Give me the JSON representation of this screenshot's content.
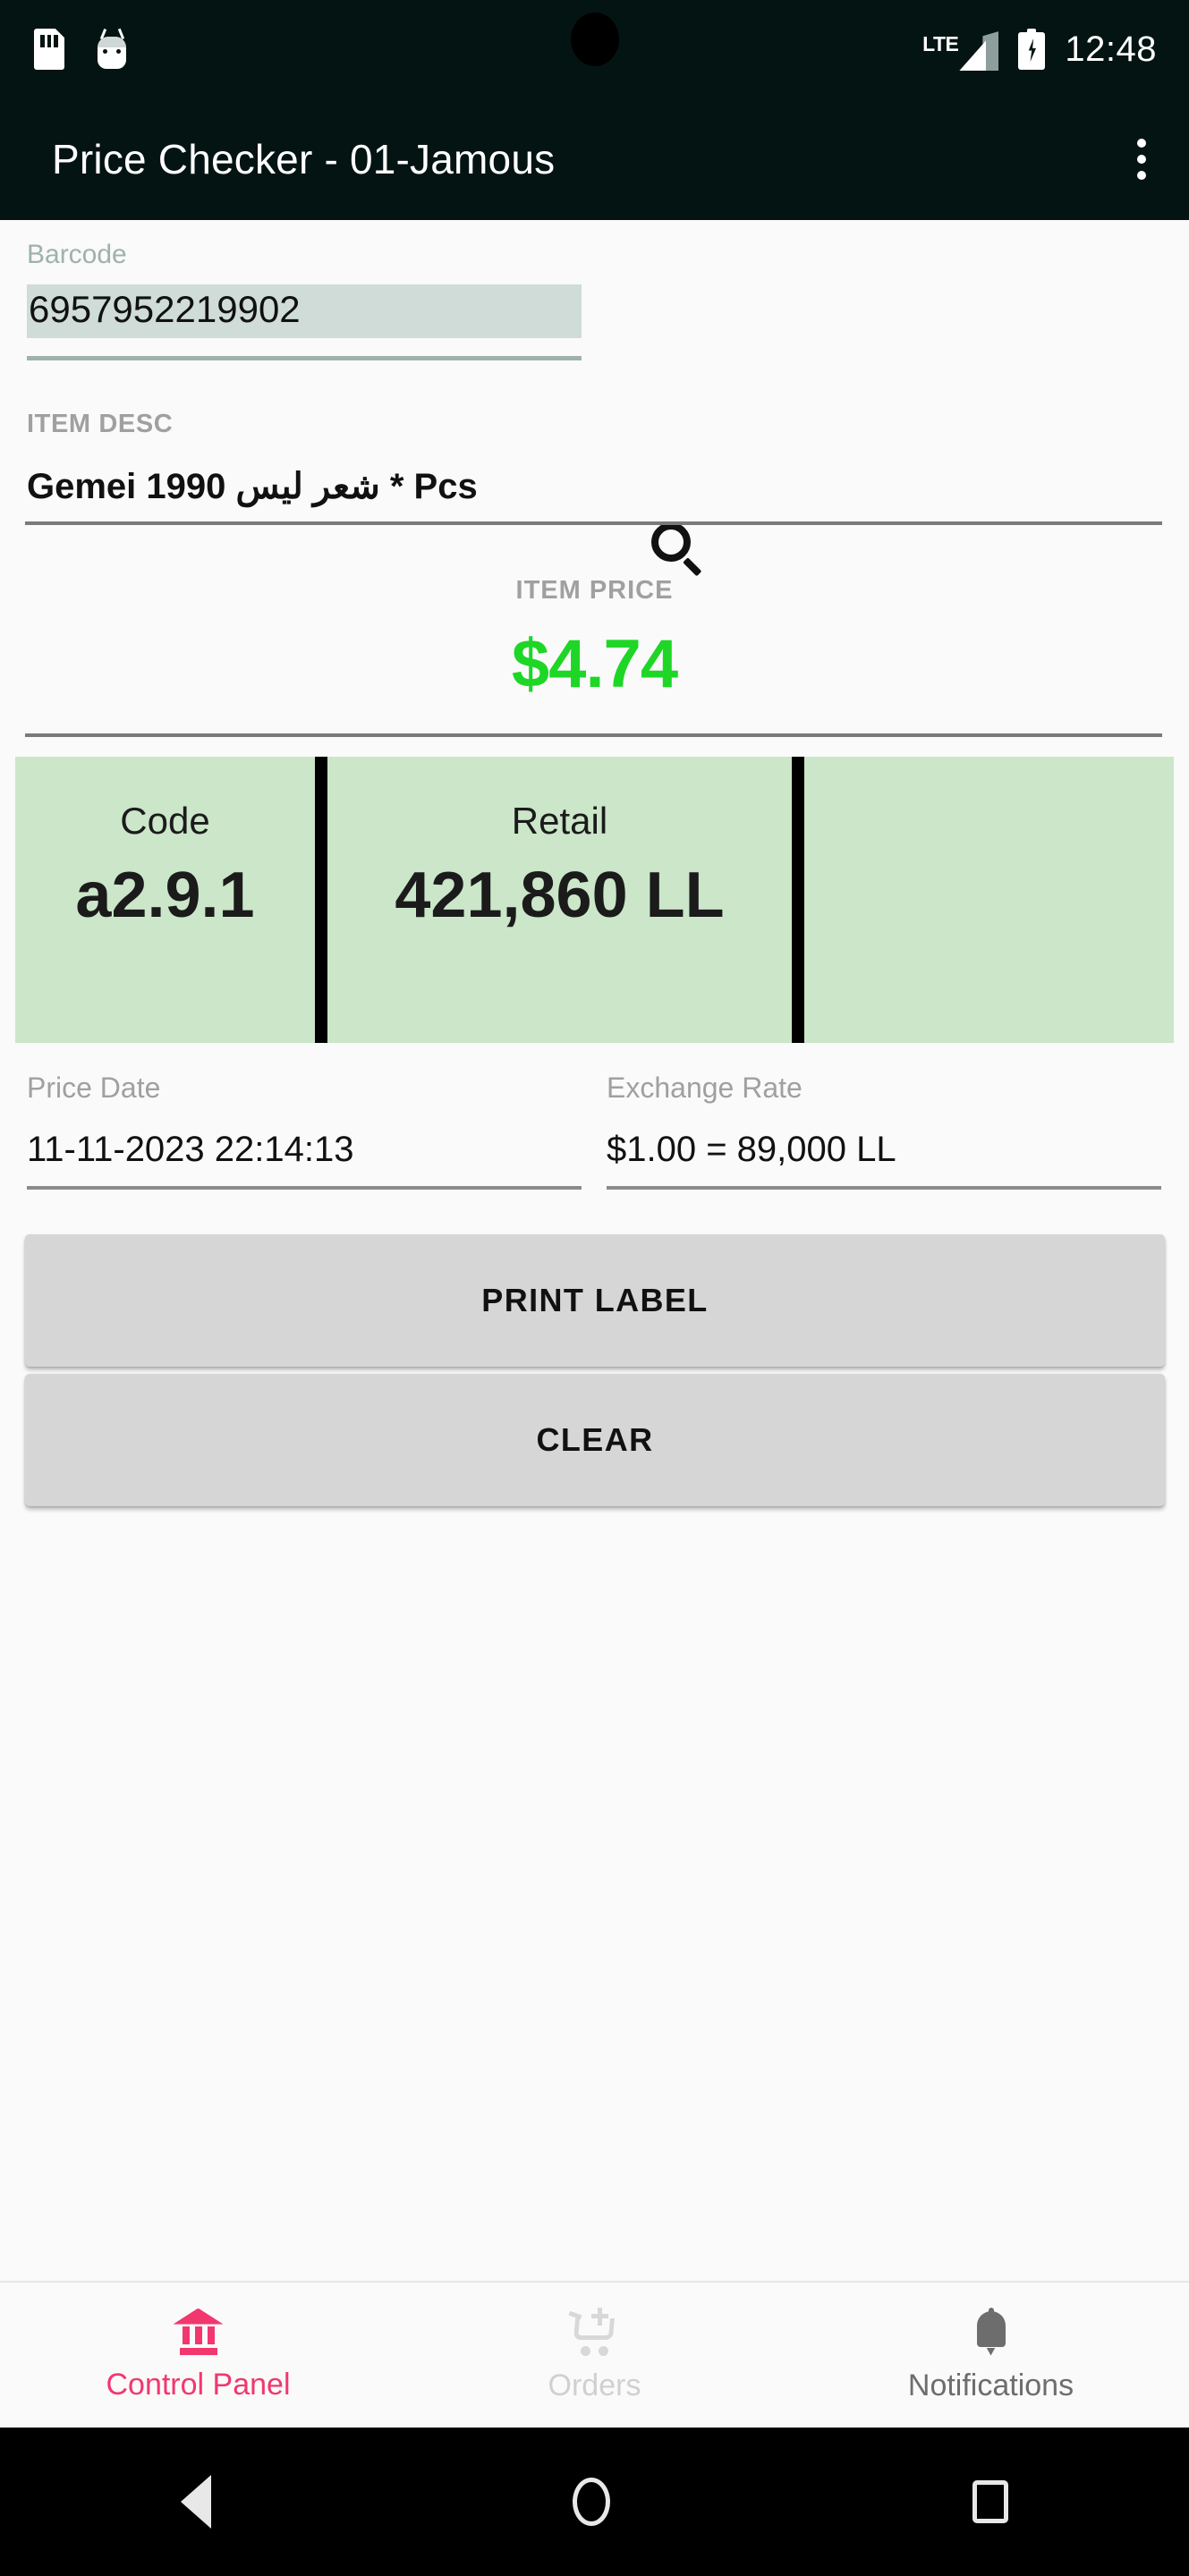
{
  "status_bar": {
    "icons": [
      "sim-card-icon",
      "android-bug-icon"
    ],
    "network_type": "LTE",
    "signal": "signal-bars-icon",
    "battery": "battery-charging-icon",
    "time": "12:48"
  },
  "app_bar": {
    "title": "Price Checker - 01-Jamous",
    "overflow_menu": "more-vert-icon"
  },
  "form": {
    "barcode": {
      "label": "Barcode",
      "value": "6957952219902",
      "placeholder": "",
      "selected": true
    },
    "search_icon": "search-icon",
    "item_desc": {
      "label": "ITEM DESC",
      "value": "Gemei 1990 شعر ليس * Pcs"
    },
    "item_price": {
      "label": "ITEM PRICE",
      "value": "$4.74",
      "color": "#1ed626"
    },
    "summary": {
      "background": "#cbe6c9",
      "cells": [
        {
          "caption": "Code",
          "value": "a2.9.1"
        },
        {
          "caption": "Retail",
          "value": "421,860 LL"
        }
      ]
    },
    "price_date": {
      "label": "Price Date",
      "value": "11-11-2023 22:14:13"
    },
    "exchange_rate": {
      "label": "Exchange Rate",
      "value": "$1.00 = 89,000 LL"
    }
  },
  "actions": {
    "print_label": "PRINT LABEL",
    "clear": "CLEAR"
  },
  "bottom_nav": {
    "active_color": "#f2376f",
    "items": [
      {
        "label": "Control Panel",
        "icon": "bank-icon",
        "state": "active"
      },
      {
        "label": "Orders",
        "icon": "add-shopping-cart-icon",
        "state": "disabled"
      },
      {
        "label": "Notifications",
        "icon": "bell-icon",
        "state": "inactive"
      }
    ]
  },
  "android_nav": {
    "back": "back-triangle-icon",
    "home": "home-circle-icon",
    "recents": "recents-square-icon"
  }
}
